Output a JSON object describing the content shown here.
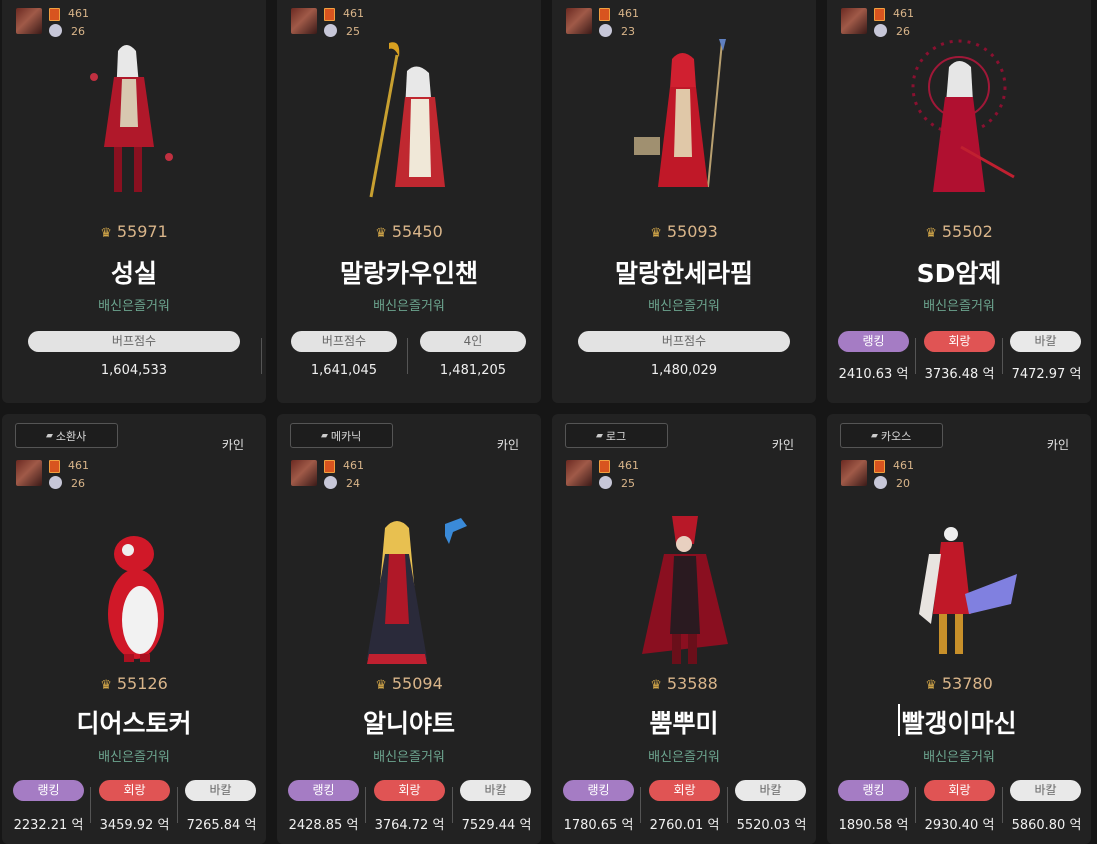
{
  "cards": [
    {
      "stats": {
        "v1": "461",
        "v2": "26"
      },
      "fame": "55971",
      "name": "성실",
      "guild": "배신은즐거워",
      "metrics": [
        {
          "label": "버프점수",
          "value": "1,604,533"
        }
      ]
    },
    {
      "stats": {
        "v1": "461",
        "v2": "25"
      },
      "fame": "55450",
      "name": "말랑카우인챈",
      "guild": "배신은즐거워",
      "metrics": [
        {
          "label": "버프점수",
          "value": "1,641,045"
        },
        {
          "label": "4인",
          "value": "1,481,205"
        }
      ]
    },
    {
      "stats": {
        "v1": "461",
        "v2": "23"
      },
      "fame": "55093",
      "name": "말랑한세라핌",
      "guild": "배신은즐거워",
      "metrics": [
        {
          "label": "버프점수",
          "value": "1,480,029"
        }
      ]
    },
    {
      "stats": {
        "v1": "461",
        "v2": "26"
      },
      "fame": "55502",
      "name": "SD암제",
      "guild": "배신은즐거워",
      "metrics": [
        {
          "label": "랭킹",
          "value": "2410.63 억"
        },
        {
          "label": "회랑",
          "value": "3736.48 억"
        },
        {
          "label": "바칼",
          "value": "7472.97 억"
        }
      ]
    },
    {
      "tag": "소환사",
      "server": "카인",
      "stats": {
        "v1": "461",
        "v2": "26"
      },
      "fame": "55126",
      "name": "디어스토커",
      "guild": "배신은즐거워",
      "metrics": [
        {
          "label": "랭킹",
          "value": "2232.21 억"
        },
        {
          "label": "회랑",
          "value": "3459.92 억"
        },
        {
          "label": "바칼",
          "value": "7265.84 억"
        }
      ]
    },
    {
      "tag": "메카닉",
      "server": "카인",
      "stats": {
        "v1": "461",
        "v2": "24"
      },
      "fame": "55094",
      "name": "알니야트",
      "guild": "배신은즐거워",
      "metrics": [
        {
          "label": "랭킹",
          "value": "2428.85 억"
        },
        {
          "label": "회랑",
          "value": "3764.72 억"
        },
        {
          "label": "바칼",
          "value": "7529.44 억"
        }
      ]
    },
    {
      "tag": "로그",
      "server": "카인",
      "stats": {
        "v1": "461",
        "v2": "25"
      },
      "fame": "53588",
      "name": "뿜뿌미",
      "guild": "배신은즐거워",
      "metrics": [
        {
          "label": "랭킹",
          "value": "1780.65 억"
        },
        {
          "label": "회랑",
          "value": "2760.01 억"
        },
        {
          "label": "바칼",
          "value": "5520.03 억"
        }
      ]
    },
    {
      "tag": "카오스",
      "server": "카인",
      "stats": {
        "v1": "461",
        "v2": "20"
      },
      "fame": "53780",
      "name": "빨갱이마신",
      "guild": "배신은즐거워",
      "metrics": [
        {
          "label": "랭킹",
          "value": "1890.58 억"
        },
        {
          "label": "회랑",
          "value": "2930.40 억"
        },
        {
          "label": "바칼",
          "value": "5860.80 억"
        }
      ]
    }
  ],
  "colors": {
    "fame": "#d9b58a",
    "guild": "#6ca48e",
    "ranking": "#a57cc4",
    "corridor": "#e05454",
    "bakal": "#e9e9e9"
  },
  "icons": {
    "fame": "crown-icon",
    "emblem": "rank-emblem-icon",
    "tag": "flag-icon"
  }
}
